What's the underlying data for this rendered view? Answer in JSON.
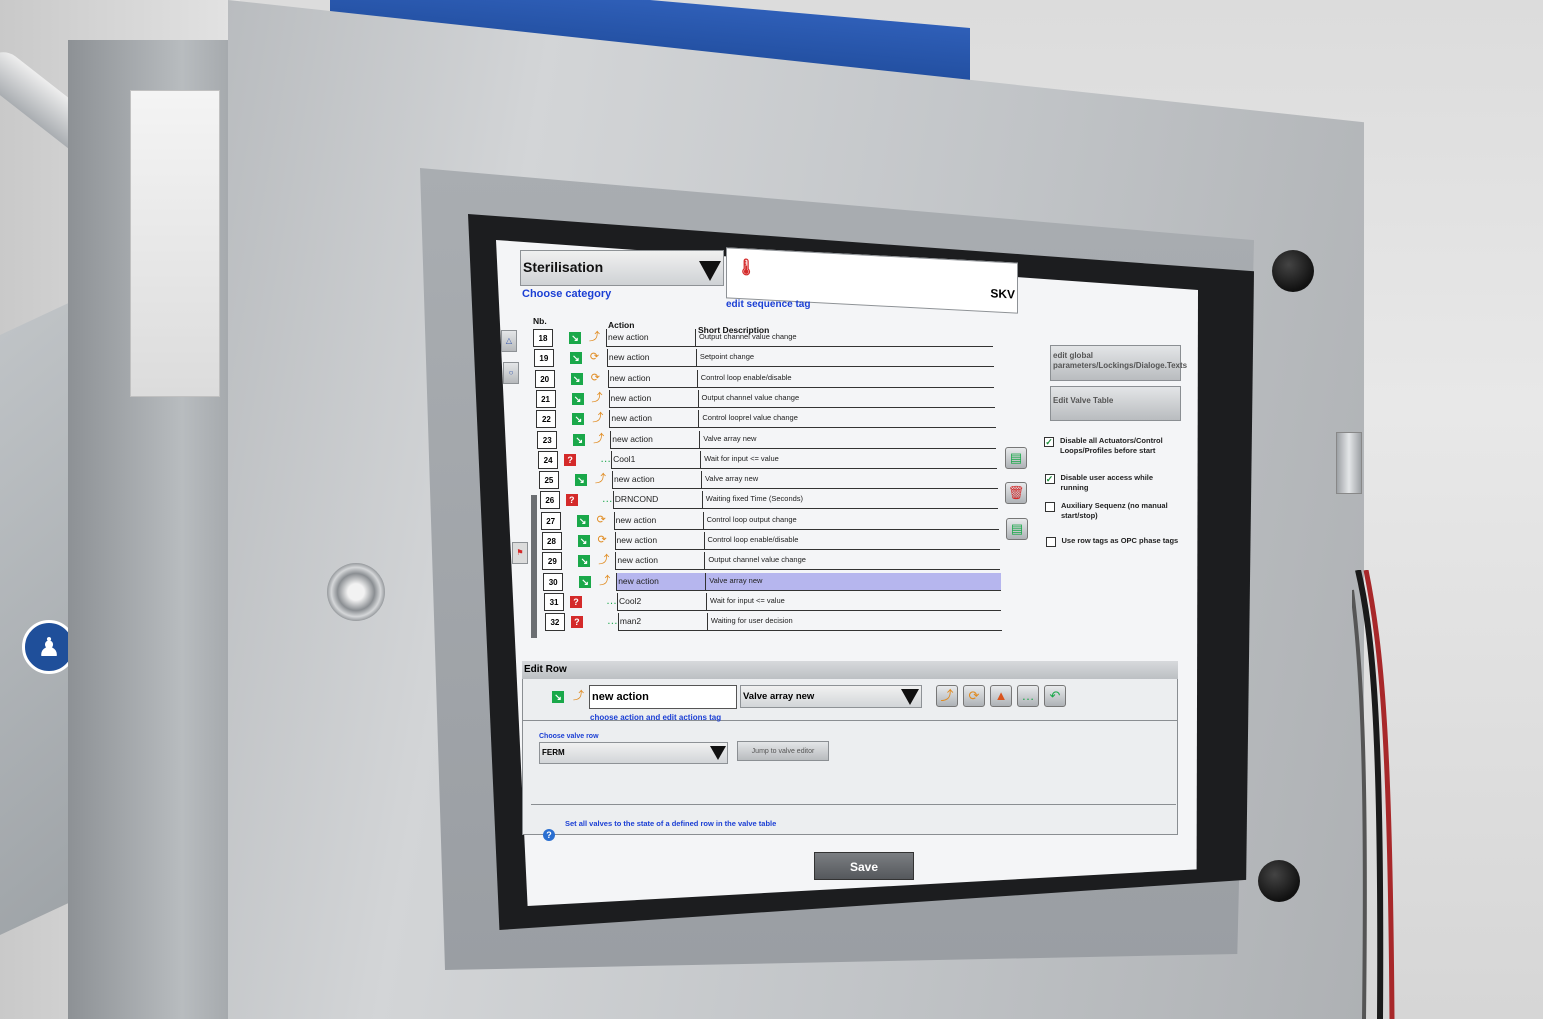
{
  "sequence": {
    "category_value": "Sterilisation",
    "category_caption": "Choose category",
    "tag_value": "SKV",
    "tag_caption": "edit sequence tag"
  },
  "table": {
    "col_nb": "Nb.",
    "col_action": "Action",
    "col_desc": "Short Description",
    "rows": [
      {
        "nb": "18",
        "status": "go",
        "icon": "output",
        "action": "new action",
        "desc": "Output channel value change"
      },
      {
        "nb": "19",
        "status": "go",
        "icon": "loop",
        "action": "new action",
        "desc": "Setpoint change"
      },
      {
        "nb": "20",
        "status": "go",
        "icon": "loop",
        "action": "new action",
        "desc": "Control loop enable/disable"
      },
      {
        "nb": "21",
        "status": "go",
        "icon": "output",
        "action": "new action",
        "desc": "Output channel value change"
      },
      {
        "nb": "22",
        "status": "go",
        "icon": "output",
        "action": "new action",
        "desc": "Control looprel value change"
      },
      {
        "nb": "23",
        "status": "go",
        "icon": "output",
        "action": "new action",
        "desc": "Valve array new"
      },
      {
        "nb": "24",
        "status": "question",
        "icon": "wait",
        "action": "Cool1",
        "desc": "Wait for input <= value"
      },
      {
        "nb": "25",
        "status": "go",
        "icon": "output",
        "action": "new action",
        "desc": "Valve array new"
      },
      {
        "nb": "26",
        "status": "question",
        "icon": "wait",
        "action": "DRNCOND",
        "desc": "Waiting fixed Time (Seconds)"
      },
      {
        "nb": "27",
        "status": "go",
        "icon": "loop",
        "action": "new action",
        "desc": "Control loop output change"
      },
      {
        "nb": "28",
        "status": "go",
        "icon": "loop",
        "action": "new action",
        "desc": "Control loop enable/disable"
      },
      {
        "nb": "29",
        "status": "go",
        "icon": "output",
        "action": "new action",
        "desc": "Output channel value change"
      },
      {
        "nb": "30",
        "status": "go",
        "icon": "output",
        "action": "new action",
        "desc": "Valve array new",
        "selected": true
      },
      {
        "nb": "31",
        "status": "question",
        "icon": "wait",
        "action": "Cool2",
        "desc": "Wait for input <= value"
      },
      {
        "nb": "32",
        "status": "question",
        "icon": "wait",
        "action": "man2",
        "desc": "Waiting for user decision"
      }
    ]
  },
  "right_panel": {
    "btn_global": "edit global parameters/Lockings/Dialoge.Texts",
    "btn_valve_table": "Edit Valve Table",
    "options": [
      {
        "label": "Disable all Actuators/Control Loops/Profiles before start",
        "checked": true
      },
      {
        "label": "Disable user access while running",
        "checked": true
      },
      {
        "label": "Auxiliary Sequenz (no manual start/stop)",
        "checked": false
      },
      {
        "label": "Use row tags as OPC phase tags",
        "checked": false
      }
    ]
  },
  "edit_row": {
    "title": "Edit Row",
    "action_value": "new action",
    "action_type": "Valve array new",
    "action_caption": "choose action and edit actions tag",
    "valve_caption": "Choose valve row",
    "valve_value": "FERM",
    "jump_label": "Jump to valve editor",
    "help_text": "Set all valves to the state of a defined row in the valve table"
  },
  "save_label": "Save",
  "colors": {
    "go": "#1aa84a",
    "question": "#d42a2a",
    "selected": "#b6b6ee",
    "caption": "#1b3fd4"
  }
}
